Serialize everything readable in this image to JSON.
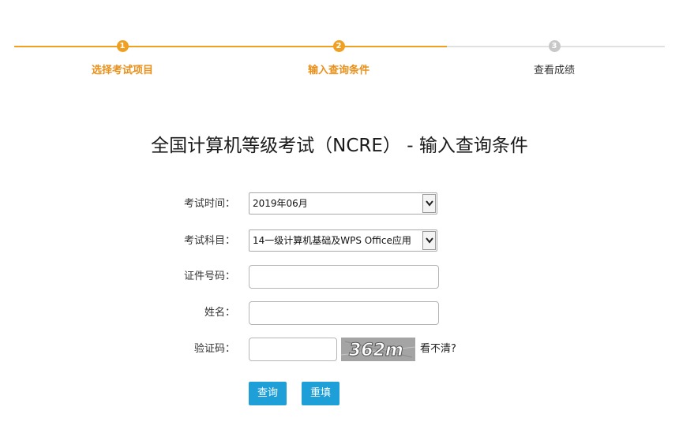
{
  "steps": [
    {
      "number": "1",
      "label": "选择考试项目",
      "state": "done"
    },
    {
      "number": "2",
      "label": "输入查询条件",
      "state": "active"
    },
    {
      "number": "3",
      "label": "查看成绩",
      "state": "pending"
    }
  ],
  "heading": "全国计算机等级考试（NCRE） - 输入查询条件",
  "form": {
    "exam_time": {
      "label": "考试时间：",
      "value": "2019年06月"
    },
    "exam_subject": {
      "label": "考试科目：",
      "value": "14一级计算机基础及WPS Office应用"
    },
    "id_number": {
      "label": "证件号码：",
      "value": ""
    },
    "name": {
      "label": "姓名：",
      "value": ""
    },
    "captcha": {
      "label": "验证码：",
      "value": "",
      "image_text": "362m",
      "refresh_label": "看不清?"
    }
  },
  "buttons": {
    "query": "查询",
    "reset": "重填"
  },
  "colors": {
    "accent_orange": "#f0a020",
    "button_blue": "#1e9fd8",
    "pending_gray": "#c8c8c8"
  }
}
